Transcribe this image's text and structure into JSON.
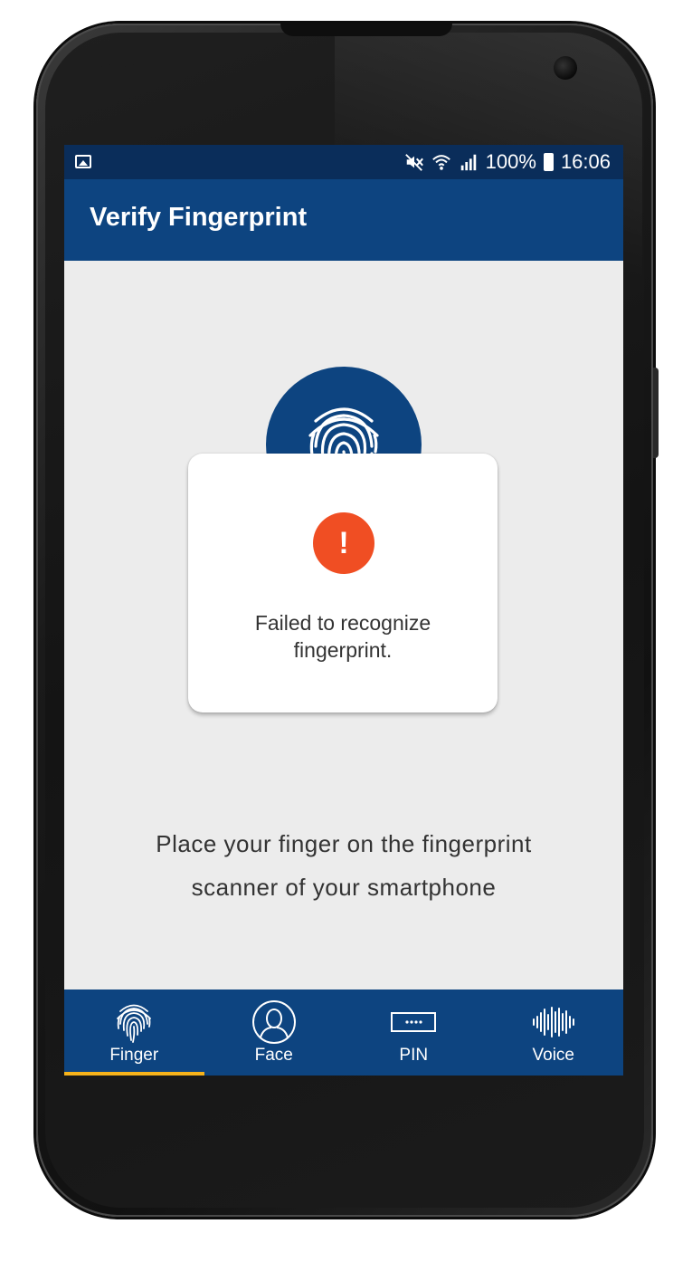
{
  "status_bar": {
    "battery_percent": "100%",
    "time": "16:06",
    "icons": [
      "image-icon",
      "mute-icon",
      "wifi-icon",
      "signal-icon",
      "battery-icon"
    ]
  },
  "app_bar": {
    "title": "Verify Fingerprint"
  },
  "dialog": {
    "alert_symbol": "!",
    "message_line1": "Failed to recognize",
    "message_line2": "fingerprint."
  },
  "instruction": {
    "line1": "Place your finger on the fingerprint",
    "line2": "scanner of your smartphone"
  },
  "bottom_nav": {
    "items": [
      {
        "label": "Finger",
        "icon": "fingerprint-icon",
        "active": true
      },
      {
        "label": "Face",
        "icon": "face-icon",
        "active": false
      },
      {
        "label": "PIN",
        "icon": "pin-icon",
        "active": false
      },
      {
        "label": "Voice",
        "icon": "voice-icon",
        "active": false
      }
    ]
  },
  "colors": {
    "status_bar": "#0a2d5a",
    "primary": "#0d4480",
    "alert": "#f04e23",
    "active_indicator": "#f5b21b",
    "background": "#ececec"
  }
}
